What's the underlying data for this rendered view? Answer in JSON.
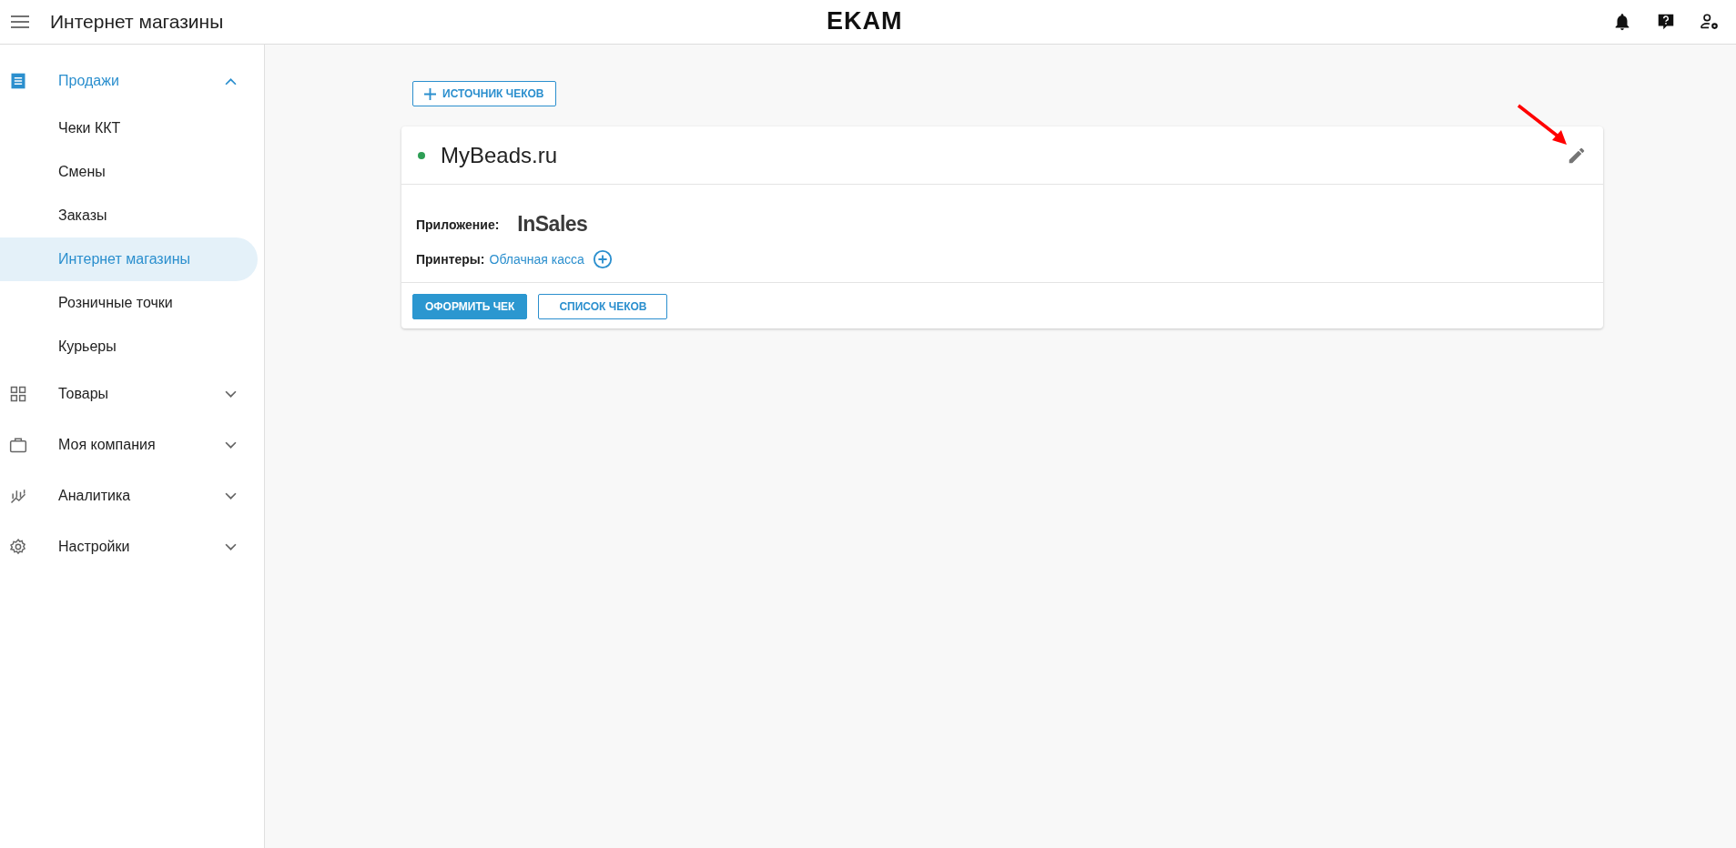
{
  "top_bar": {
    "title": "Интернет магазины",
    "logo": "EKAM"
  },
  "sidebar": {
    "items": [
      {
        "label": "Продажи",
        "selected": true,
        "expanded": true,
        "children": [
          {
            "label": "Чеки ККТ",
            "selected": false
          },
          {
            "label": "Смены",
            "selected": false
          },
          {
            "label": "Заказы",
            "selected": false
          },
          {
            "label": "Интернет магазины",
            "selected": true
          },
          {
            "label": "Розничные точки",
            "selected": false
          },
          {
            "label": "Курьеры",
            "selected": false
          }
        ]
      },
      {
        "label": "Товары",
        "selected": false,
        "expanded": false
      },
      {
        "label": "Моя компания",
        "selected": false,
        "expanded": false
      },
      {
        "label": "Аналитика",
        "selected": false,
        "expanded": false
      },
      {
        "label": "Настройки",
        "selected": false,
        "expanded": false
      }
    ]
  },
  "add_button": "ИСТОЧНИК ЧЕКОВ",
  "card": {
    "title": "MyBeads.ru",
    "active": true,
    "app_label": "Приложение:",
    "app_logo": "InSales",
    "printers_label": "Принтеры:",
    "printer": "Облачная касса",
    "buttons": [
      {
        "label": "ОФОРМИТЬ ЧЕК",
        "kind": "primary"
      },
      {
        "label": "СПИСОК ЧЕКОВ",
        "kind": "outline"
      }
    ]
  }
}
